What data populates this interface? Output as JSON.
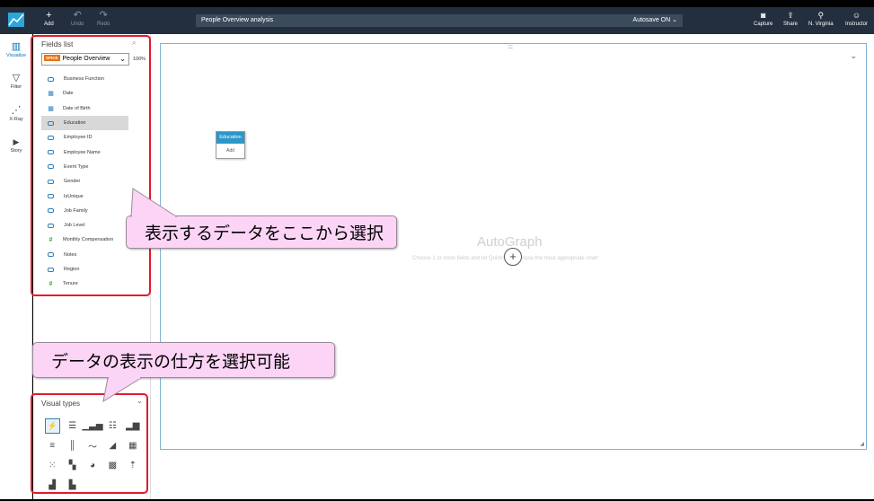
{
  "topbar": {
    "add_label": "Add",
    "undo_label": "Undo",
    "redo_label": "Redo",
    "analysis_name": "People Overview analysis",
    "autosave": "Autosave ON",
    "capture_label": "Capture",
    "share_label": "Share",
    "region_label": "N. Virginia",
    "user_label": "Instructor"
  },
  "sidebar": {
    "items": [
      {
        "label": "Visualize",
        "icon": "bar-chart-icon"
      },
      {
        "label": "Filter",
        "icon": "funnel-icon"
      },
      {
        "label": "X-Ray",
        "icon": "trend-icon"
      },
      {
        "label": "Story",
        "icon": "play-icon"
      }
    ]
  },
  "fields_panel": {
    "title": "Fields list",
    "dataset_badge": "SPICE",
    "dataset_name": "People Overview",
    "spice_percent": "100%",
    "fields": [
      {
        "name": "Business Function",
        "type": "dimension"
      },
      {
        "name": "Date",
        "type": "date"
      },
      {
        "name": "Date of Birth",
        "type": "date"
      },
      {
        "name": "Education",
        "type": "dimension"
      },
      {
        "name": "Employee ID",
        "type": "dimension"
      },
      {
        "name": "Employee Name",
        "type": "dimension"
      },
      {
        "name": "Event Type",
        "type": "dimension"
      },
      {
        "name": "Gender",
        "type": "dimension"
      },
      {
        "name": "IsUnique",
        "type": "dimension"
      },
      {
        "name": "Job Family",
        "type": "dimension"
      },
      {
        "name": "Job Level",
        "type": "dimension"
      },
      {
        "name": "Monthly Compensation",
        "type": "measure"
      },
      {
        "name": "Notes",
        "type": "dimension"
      },
      {
        "name": "Region",
        "type": "dimension"
      },
      {
        "name": "Tenure",
        "type": "measure"
      }
    ]
  },
  "visual_types": {
    "title": "Visual types"
  },
  "canvas": {
    "autograph_title": "AutoGraph",
    "autograph_hint": "Choose 1 or more fields and let QuickSight choose the most appropriate chart",
    "drag_card_title": "Education",
    "drag_card_action": "Add"
  },
  "callouts": {
    "fields": "表示するデータをここから選択",
    "visual_types": "データの表示の仕方を選択可能"
  },
  "colors": {
    "topbar": "#232f3e",
    "accent": "#0073bb",
    "highlight_box": "#e01a2b",
    "callout_bg": "#fbd4f6",
    "spice_badge": "#ec7211"
  }
}
